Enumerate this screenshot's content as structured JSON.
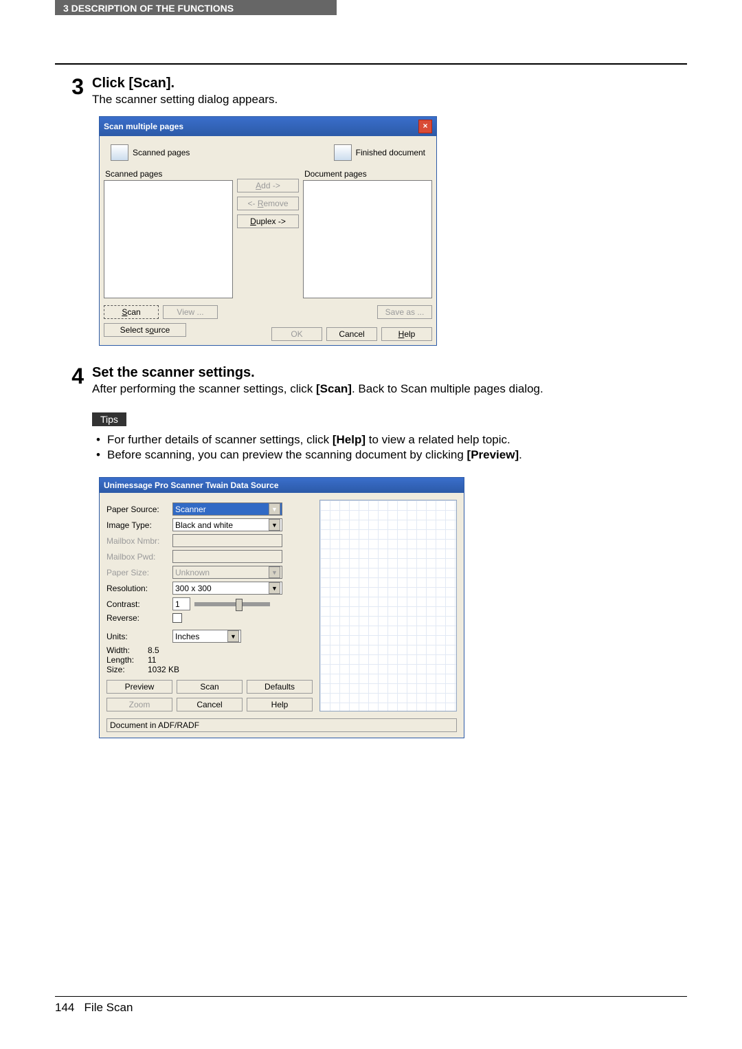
{
  "header": {
    "section_label": "3   DESCRIPTION OF THE FUNCTIONS"
  },
  "step3": {
    "num": "3",
    "title": "Click [Scan].",
    "desc": "The scanner setting dialog appears."
  },
  "dlg1": {
    "title": "Scan multiple pages",
    "close": "×",
    "scanned_pages_hdr": "Scanned pages",
    "finished_hdr": "Finished document",
    "scanned_group": "Scanned pages",
    "doc_group": "Document pages",
    "btn_add": "Add ->",
    "btn_remove": "<- Remove",
    "btn_duplex": "Duplex ->",
    "btn_scan": "Scan",
    "btn_view": "View ...",
    "btn_select_source": "Select source",
    "btn_saveas": "Save as ...",
    "btn_ok": "OK",
    "btn_cancel": "Cancel",
    "btn_help": "Help",
    "underline_scan": "S",
    "underline_duplex": "D",
    "underline_remove": "R",
    "underline_add": "A",
    "underline_source": "o",
    "underline_help": "H"
  },
  "step4": {
    "num": "4",
    "title": "Set the scanner settings.",
    "desc_pre": "After performing the scanner settings, click ",
    "desc_bold": "[Scan]",
    "desc_post": ". Back to Scan multiple pages dialog."
  },
  "tips": {
    "label": "Tips",
    "b1_pre": "For further details of scanner settings, click ",
    "b1_bold": "[Help]",
    "b1_post": " to view a related help topic.",
    "b2_pre": "Before scanning, you can preview the scanning document by clicking ",
    "b2_bold": "[Preview]",
    "b2_post": "."
  },
  "dlg2": {
    "title": "Unimessage Pro Scanner Twain Data Source",
    "l_paper_source": "Paper Source:",
    "v_paper_source": "Scanner",
    "l_image_type": "Image Type:",
    "v_image_type": "Black and white",
    "l_mailbox_num": "Mailbox Nmbr:",
    "l_mailbox_pwd": "Mailbox Pwd:",
    "l_paper_size": "Paper Size:",
    "v_paper_size": "Unknown",
    "l_resolution": "Resolution:",
    "v_resolution": "300 x 300",
    "l_contrast": "Contrast:",
    "v_contrast": "1",
    "l_reverse": "Reverse:",
    "l_units": "Units:",
    "v_units": "Inches",
    "l_width": "Width:",
    "v_width": "8.5",
    "l_length": "Length:",
    "v_length": "11",
    "l_size": "Size:",
    "v_size": "1032 KB",
    "btn_preview": "Preview",
    "btn_scan": "Scan",
    "btn_defaults": "Defaults",
    "btn_zoom": "Zoom",
    "btn_cancel": "Cancel",
    "btn_help": "Help",
    "status": "Document in ADF/RADF"
  },
  "footer": {
    "page": "144",
    "chapter": "File Scan"
  }
}
